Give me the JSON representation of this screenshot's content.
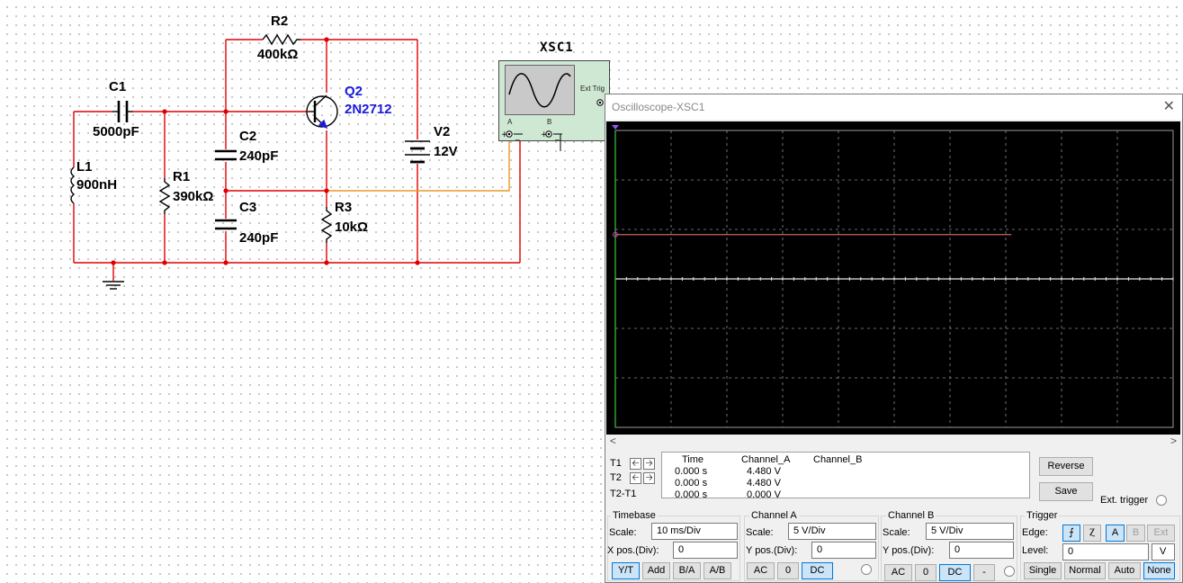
{
  "schematic": {
    "r2": {
      "name": "R2",
      "value": "400kΩ"
    },
    "c1": {
      "name": "C1",
      "value": "5000pF"
    },
    "q2": {
      "name": "Q2",
      "value": "2N2712"
    },
    "c2": {
      "name": "C2",
      "value": "240pF"
    },
    "l1": {
      "name": "L1",
      "value": "900nH"
    },
    "r1": {
      "name": "R1",
      "value": "390kΩ"
    },
    "c3": {
      "name": "C3",
      "value": "240pF"
    },
    "r3": {
      "name": "R3",
      "value": "10kΩ"
    },
    "v2": {
      "name": "V2",
      "value": "12V"
    },
    "xsc1": {
      "name": "XSC1",
      "ext_trig": "Ext Trig",
      "term_a": "A",
      "term_b": "B"
    }
  },
  "window": {
    "title": "Oscilloscope-XSC1",
    "close": "✕"
  },
  "readout": {
    "t1": "T1",
    "t2": "T2",
    "t2t1": "T2-T1",
    "headers": {
      "time": "Time",
      "channel_a": "Channel_A",
      "channel_b": "Channel_B"
    },
    "rows": [
      {
        "time": "0.000 s",
        "a": "4.480 V",
        "b": ""
      },
      {
        "time": "0.000 s",
        "a": "4.480 V",
        "b": ""
      },
      {
        "time": "0.000 s",
        "a": "0.000 V",
        "b": ""
      }
    ],
    "reverse": "Reverse",
    "save": "Save",
    "ext_trigger": "Ext. trigger"
  },
  "timebase": {
    "title": "Timebase",
    "scale_label": "Scale:",
    "scale": "10 ms/Div",
    "xpos_label": "X pos.(Div):",
    "xpos": "0",
    "buttons": [
      "Y/T",
      "Add",
      "B/A",
      "A/B"
    ]
  },
  "channel_a": {
    "title": "Channel A",
    "scale_label": "Scale:",
    "scale": "5  V/Div",
    "ypos_label": "Y pos.(Div):",
    "ypos": "0",
    "buttons": [
      "AC",
      "0",
      "DC"
    ]
  },
  "channel_b": {
    "title": "Channel B",
    "scale_label": "Scale:",
    "scale": "5  V/Div",
    "ypos_label": "Y pos.(Div):",
    "ypos": "0",
    "buttons": [
      "AC",
      "0",
      "DC",
      "-"
    ]
  },
  "trigger": {
    "title": "Trigger",
    "edge_label": "Edge:",
    "edge_rise": "⨍",
    "edge_fall": "Ⲍ",
    "sources": [
      "A",
      "B",
      "Ext"
    ],
    "level_label": "Level:",
    "level": "0",
    "level_unit": "V",
    "modes": [
      "Single",
      "Normal",
      "Auto",
      "None"
    ]
  },
  "colors": {
    "wire": "#e00000",
    "probe_wire": "#e89a28",
    "trace_a": "#c86464",
    "screen_bg": "#000000",
    "selected_button": "#cce4f7"
  }
}
